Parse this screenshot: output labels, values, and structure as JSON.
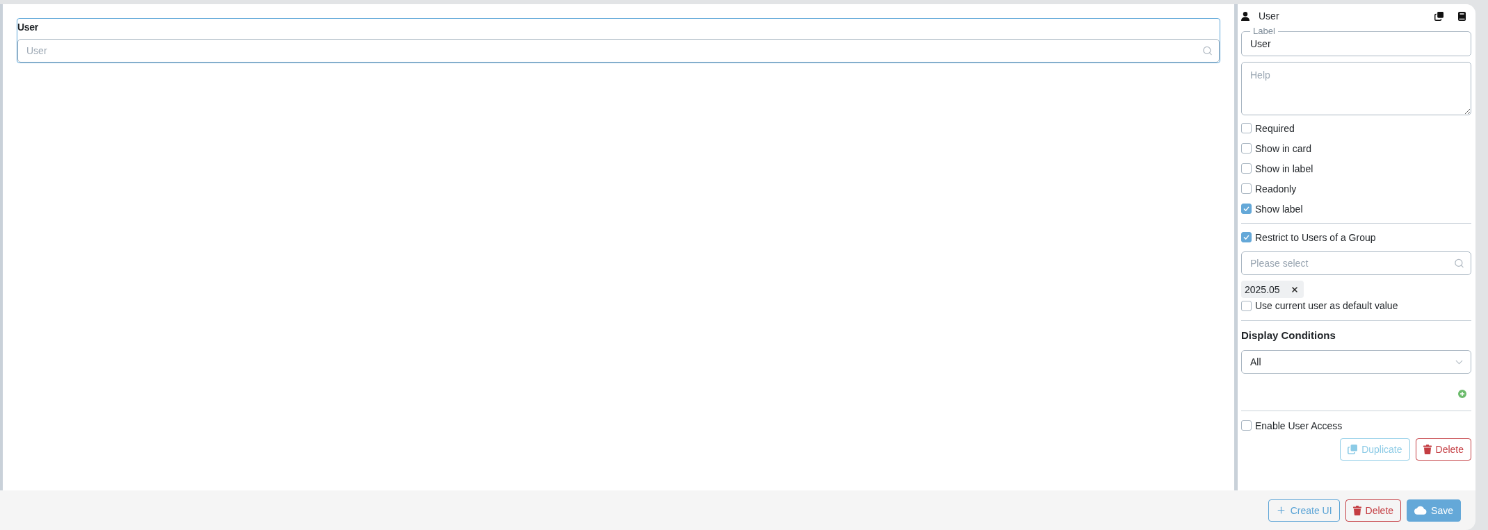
{
  "preview": {
    "label": "User",
    "placeholder": "User"
  },
  "panel": {
    "title": "User",
    "label_field": {
      "label": "Label",
      "value": "User"
    },
    "help_field": {
      "placeholder": "Help"
    },
    "options": [
      {
        "label": "Required",
        "checked": false
      },
      {
        "label": "Show in card",
        "checked": false
      },
      {
        "label": "Show in label",
        "checked": false
      },
      {
        "label": "Readonly",
        "checked": false
      },
      {
        "label": "Show label",
        "checked": true
      }
    ],
    "restrict": {
      "label": "Restrict to Users of a Group",
      "checked": true
    },
    "group_select": {
      "placeholder": "Please select"
    },
    "chips": [
      {
        "label": "2025.05"
      }
    ],
    "default_user": {
      "label": "Use current user as default value",
      "checked": false
    },
    "display_conditions": {
      "title": "Display Conditions",
      "value": "All"
    },
    "user_access": {
      "label": "Enable User Access",
      "checked": false
    },
    "actions": [
      {
        "label": "Duplicate",
        "kind": "duplicate",
        "disabled": true
      },
      {
        "label": "Delete",
        "kind": "delete",
        "disabled": false
      }
    ]
  },
  "footer": {
    "buttons": [
      {
        "label": "Create UI",
        "kind": "create"
      },
      {
        "label": "Delete",
        "kind": "delete"
      },
      {
        "label": "Save",
        "kind": "save"
      }
    ]
  }
}
